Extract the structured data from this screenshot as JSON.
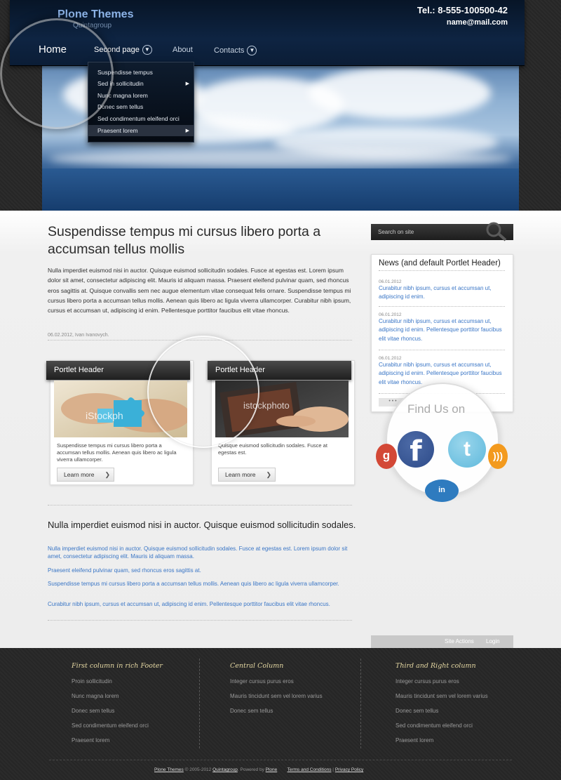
{
  "header": {
    "logo_title": "Plone Themes",
    "logo_subtitle": "Quintagroup",
    "phone": "Tel.: 8-555-100500-42",
    "email": "name@mail.com",
    "nav": {
      "home": "Home",
      "second_page": "Second page",
      "about": "About",
      "contacts": "Contacts"
    },
    "dropdown": [
      "Suspendisse tempus",
      "Sed in sollicitudin",
      "Nunc magna lorem",
      "Donec sem tellus",
      "Sed condimentum eleifend orci",
      "Praesent lorem"
    ]
  },
  "main": {
    "title": "Suspendisse tempus mi cursus libero porta a accumsan tellus mollis",
    "intro": "Nulla imperdiet euismod nisi in auctor. Quisque euismod sollicitudin sodales. Fusce at egestas est. Lorem ipsum dolor sit amet, consectetur adipiscing elit. Mauris id aliquam massa. Praesent eleifend pulvinar quam, sed rhoncus eros sagittis at. Quisque convallis sem nec augue elementum vitae consequat felis ornare. Suspendisse tempus mi cursus libero porta a accumsan tellus mollis. Aenean quis libero ac ligula viverra ullamcorper. Curabitur nibh ipsum, cursus et accumsan ut, adipiscing id enim. Pellentesque porttitor faucibus elit vitae rhoncus.",
    "byline": "06.02.2012, Ivan Ivanovych.",
    "portlets": [
      {
        "header": "Portlet Header",
        "image_watermark": "iStockph",
        "text": "Suspendisse tempus mi cursus libero porta a accumsan tellus mollis. Aenean quis libero ac ligula viverra ullamcorper.",
        "button": "Learn more"
      },
      {
        "header": "Portlet Header",
        "image_watermark": "istockphoto",
        "text": "Quisque euismod sollicitudin sodales. Fusce at egestas est.",
        "button": "Learn more"
      }
    ],
    "subtitle": "Nulla imperdiet euismod nisi in auctor. Quisque euismod sollicitudin sodales.",
    "paragraphs": [
      "Nulla imperdiet euismod nisi in auctor. Quisque euismod sollicitudin sodales. Fusce at egestas est. Lorem ipsum dolor sit amet, consectetur adipiscing elit. Mauris id aliquam massa.",
      "Praesent eleifend pulvinar quam, sed rhoncus eros sagittis at.",
      "Suspendisse tempus mi cursus libero porta a accumsan tellus mollis. Aenean quis libero ac ligula viverra ullamcorper.",
      "Curabitur nibh ipsum, cursus et accumsan ut, adipiscing id enim. Pellentesque porttitor faucibus elit vitae rhoncus."
    ]
  },
  "sidebar": {
    "search_placeholder": "Search on site",
    "news_header": "News (and default Portlet Header)",
    "news": [
      {
        "date": "06.01.2012",
        "text": "Curabitur nibh ipsum, cursus et accumsan ut, adipiscing id enim."
      },
      {
        "date": "06.01.2012",
        "text": "Curabitur nibh ipsum, cursus et accumsan ut, adipiscing id enim. Pellentesque porttitor faucibus elit vitae rhoncus."
      },
      {
        "date": "06.01.2012",
        "text": "Curabitur nibh ipsum, cursus et accumsan ut, adipiscing id enim. Pellentesque porttitor faucibus elit vitae rhoncus."
      }
    ],
    "news_more": "• • •",
    "find_us": "Find Us on",
    "social": [
      "google-plus",
      "facebook",
      "twitter",
      "rss",
      "linkedin"
    ]
  },
  "site_actions": {
    "site_actions": "Site Actions",
    "login": "Login"
  },
  "footer": {
    "columns": [
      {
        "title": "First column in rich Footer",
        "items": [
          "Proin sollicitudin",
          "Nunc magna lorem",
          "Donec sem tellus",
          "Sed condimentum eleifend orci",
          "Praesent lorem"
        ]
      },
      {
        "title": "Central Column",
        "items": [
          "Integer cursus purus eros",
          "Mauris tincidunt sem vel lorem varius",
          "Donec sem tellus"
        ]
      },
      {
        "title": "Third and Right column",
        "items": [
          "Integer cursus purus eros",
          "Mauris tincidunt sem vel lorem varius",
          "Donec sem tellus",
          "Sed condimentum eleifend orci",
          "Praesent lorem"
        ]
      }
    ],
    "bottom": {
      "plone_themes": "Plone Themes",
      "copyright": "© 2005-2012",
      "quintagroup": "Quintagroup",
      "powered_by": ". Powered by",
      "plone": "Plone",
      "terms": "Terms and Conditions",
      "sep": "|",
      "privacy": "Privacy Policy"
    }
  },
  "colors": {
    "link": "#3a76c6",
    "footer_heading": "#e4d7a2",
    "header_navy": "#0e2442"
  }
}
